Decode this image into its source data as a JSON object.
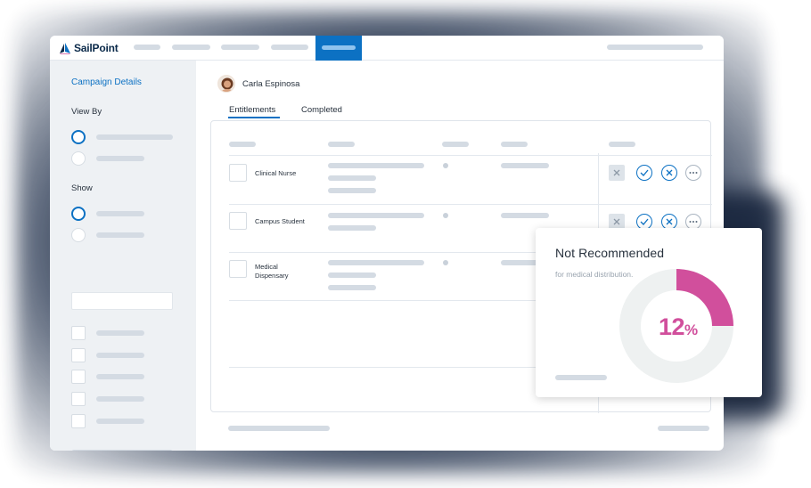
{
  "brand": {
    "name": "SailPoint",
    "accent": "#0c71c3",
    "highlight": "#d14f9c"
  },
  "sidebar": {
    "title": "Campaign Details",
    "view_by_label": "View By",
    "show_label": "Show"
  },
  "user": {
    "name": "Carla Espinosa"
  },
  "tabs": [
    {
      "label": "Entitlements",
      "active": true
    },
    {
      "label": "Completed",
      "active": false
    }
  ],
  "table": {
    "rows": [
      {
        "name": "Clinical Nurse"
      },
      {
        "name": "Campus Student"
      },
      {
        "name": "Medical Dispensary"
      }
    ],
    "action_icons": [
      "close-square-icon",
      "check-circle-icon",
      "x-circle-icon",
      "more-circle-icon"
    ]
  },
  "card": {
    "title": "Not Recommended",
    "subtitle": "for medical distribution.",
    "percent_value": "12",
    "percent_sign": "%",
    "percent_fraction": 0.12
  }
}
